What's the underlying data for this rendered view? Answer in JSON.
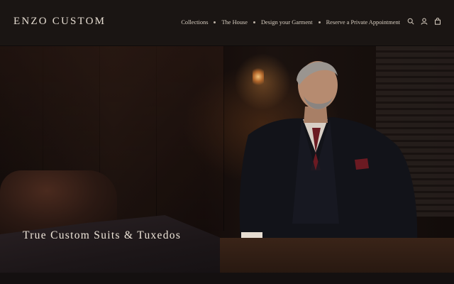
{
  "header": {
    "brand": "ENZO CUSTOM",
    "nav": [
      {
        "label": "Collections"
      },
      {
        "label": "The House"
      },
      {
        "label": "Design your Garment"
      },
      {
        "label": "Reserve a Private Appointment"
      }
    ],
    "icons": [
      "search-icon",
      "account-icon",
      "cart-icon"
    ]
  },
  "hero": {
    "headline": "True Custom Suits & Tuxedos",
    "image_subject": "man-in-dark-suit-photo"
  },
  "colors": {
    "header_bg": "#1a1513",
    "text": "#e6ddd2",
    "hero_bg": "#1c120e"
  }
}
